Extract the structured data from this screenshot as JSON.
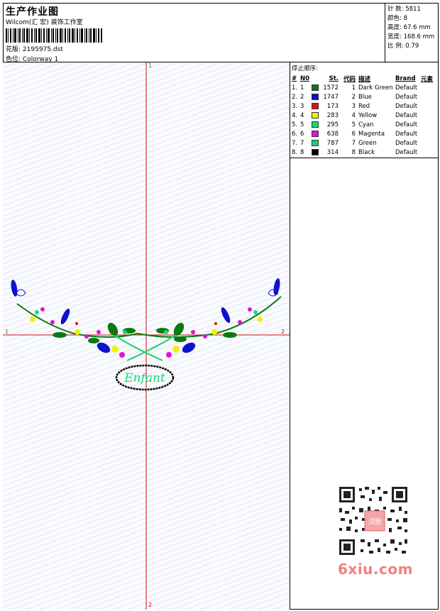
{
  "header": {
    "title": "生产作业图",
    "company": "Wilcom(汇 宏) 装饰工作室",
    "design_label": "花版:",
    "design_value": "2195975.dst",
    "colorway_label": "色位:",
    "colorway_value": "Colorway 1"
  },
  "stats": {
    "stitches": "针 数: 5811",
    "colors": "颜色: 8",
    "height": "高度: 67.6 mm",
    "width": "宽度: 168.6 mm",
    "scale": "比 例: 0.79"
  },
  "stops": {
    "title": "停止顺序:",
    "headers": {
      "num": "#",
      "no": "N0",
      "st": "St.",
      "code": "代码",
      "desc": "描述",
      "brand": "Brand",
      "element": "元素"
    },
    "rows": [
      {
        "num": "1.",
        "no": "1",
        "color": "#0a7a10",
        "st": "1572",
        "code": "1",
        "desc": "Dark Green",
        "brand": "Default"
      },
      {
        "num": "2.",
        "no": "2",
        "color": "#1010d0",
        "st": "1747",
        "code": "2",
        "desc": "Blue",
        "brand": "Default"
      },
      {
        "num": "3.",
        "no": "3",
        "color": "#e01010",
        "st": "173",
        "code": "3",
        "desc": "Red",
        "brand": "Default"
      },
      {
        "num": "4.",
        "no": "4",
        "color": "#f0f010",
        "st": "283",
        "code": "4",
        "desc": "Yellow",
        "brand": "Default"
      },
      {
        "num": "5.",
        "no": "5",
        "color": "#10e070",
        "st": "295",
        "code": "5",
        "desc": "Cyan",
        "brand": "Default"
      },
      {
        "num": "6.",
        "no": "6",
        "color": "#e010e0",
        "st": "638",
        "code": "6",
        "desc": "Magenta",
        "brand": "Default"
      },
      {
        "num": "7.",
        "no": "7",
        "color": "#20d070",
        "st": "787",
        "code": "7",
        "desc": "Green",
        "brand": "Default"
      },
      {
        "num": "8.",
        "no": "8",
        "color": "#000000",
        "st": "314",
        "code": "8",
        "desc": "Black",
        "brand": "Default"
      }
    ]
  },
  "axes": {
    "top": "1",
    "bottom": "2",
    "left": "1",
    "right": "2"
  },
  "design": {
    "text": "Enfant"
  },
  "watermark": {
    "text": "6xiu.com",
    "stamp": "汉图"
  }
}
